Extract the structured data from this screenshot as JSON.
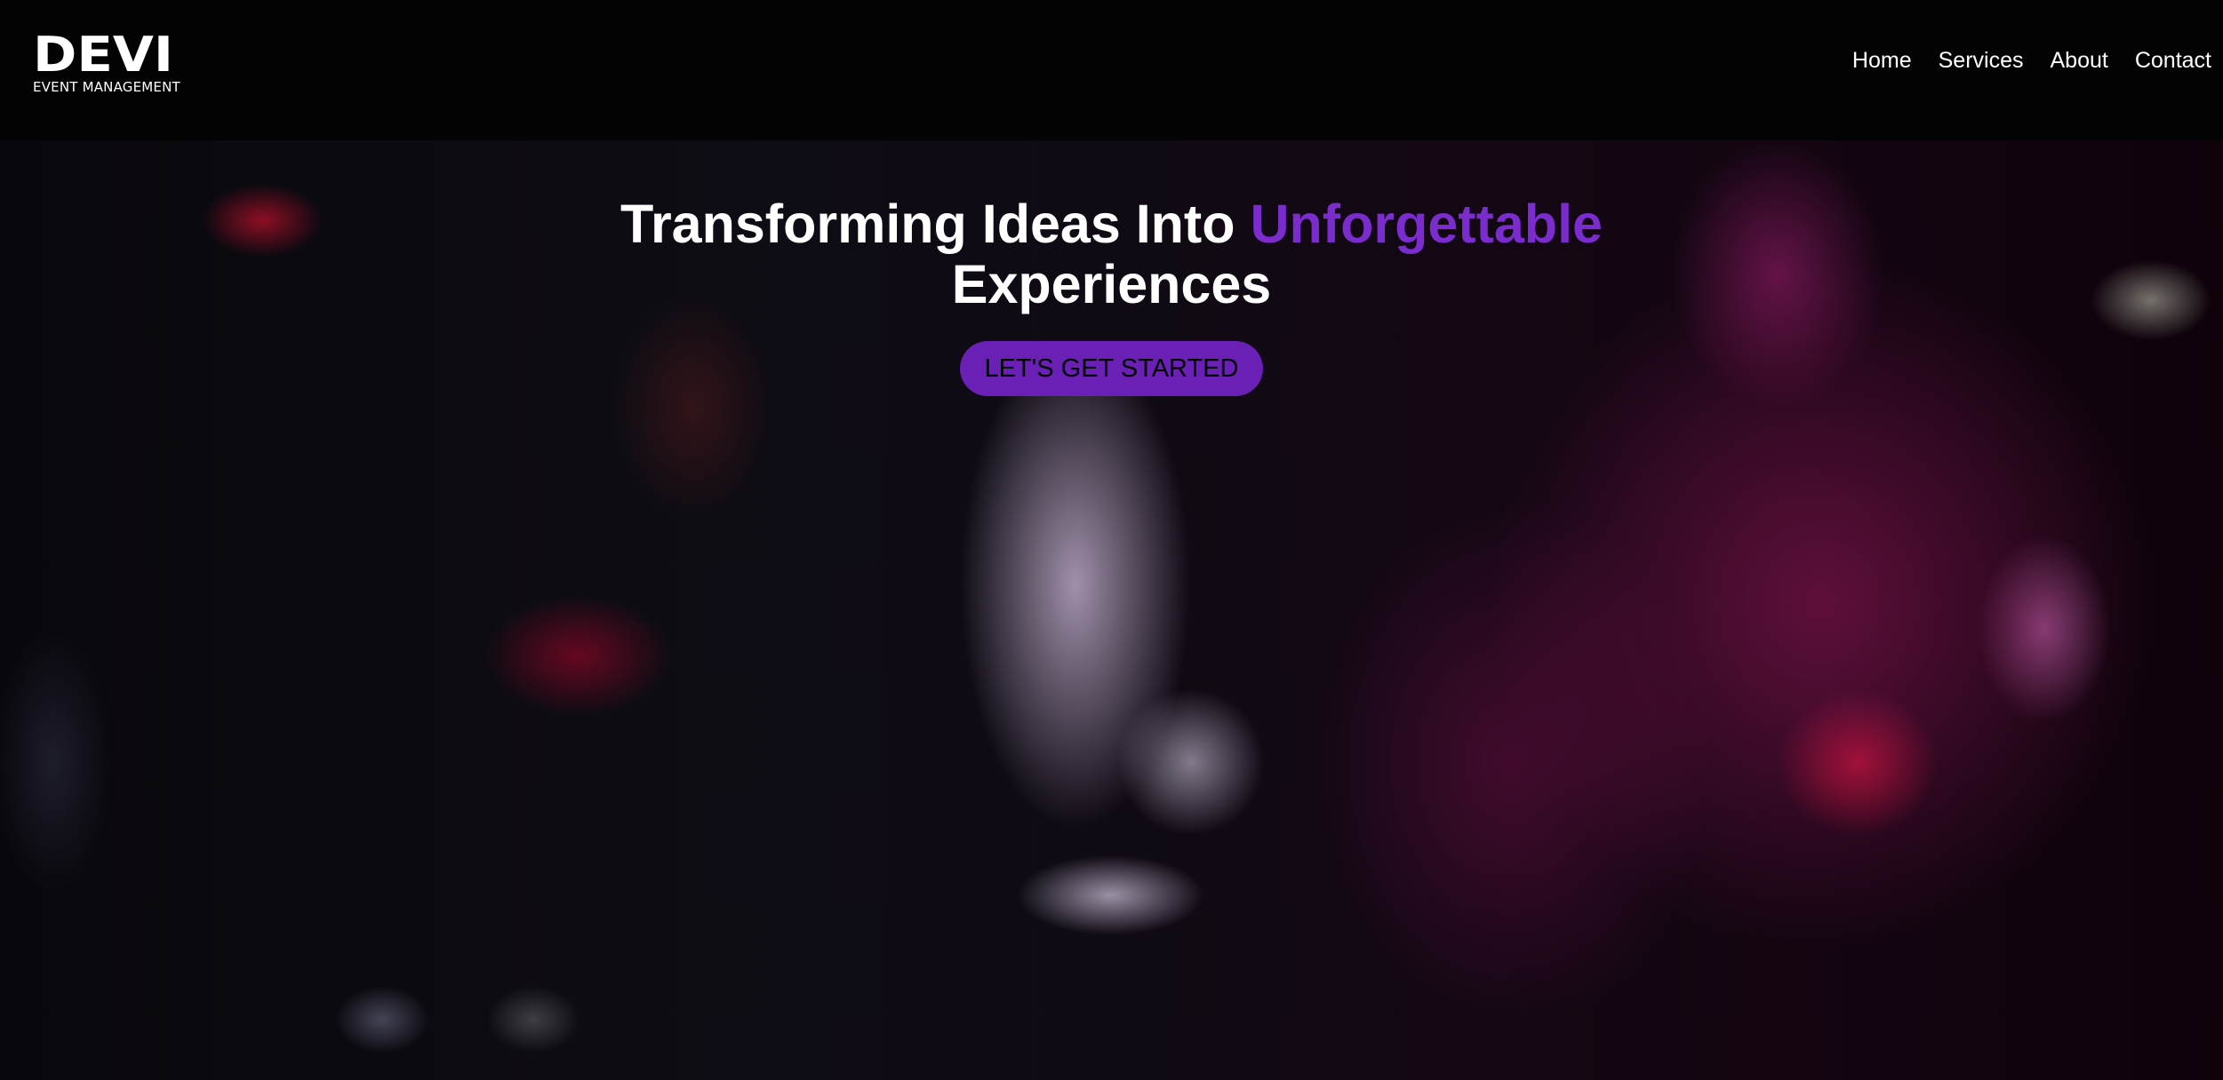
{
  "header": {
    "logo_text": "DEVI",
    "logo_subtitle": "EVENT MANAGEMENT",
    "nav": [
      {
        "label": "Home"
      },
      {
        "label": "Services"
      },
      {
        "label": "About"
      },
      {
        "label": "Contact"
      }
    ]
  },
  "hero": {
    "title_part1": "Transforming Ideas Into ",
    "title_accent": "Unforgettable",
    "title_part2": "Experiences",
    "cta_label": "LET'S GET STARTED"
  },
  "colors": {
    "background": "#000000",
    "header": "#030303",
    "accent": "#7a2ccd",
    "button": "#6a1fb5",
    "text": "#ffffff"
  }
}
